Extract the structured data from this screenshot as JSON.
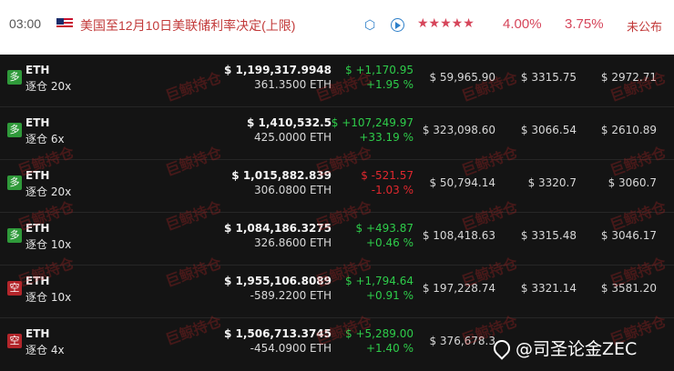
{
  "header": {
    "time": "03:00",
    "title": "美国至12月10日美联储利率决定(上限)",
    "stars": "★★★★★",
    "actual": "4.00%",
    "forecast": "3.75%",
    "status": "未公布"
  },
  "rows": [
    {
      "side": "多",
      "side_type": "long",
      "symbol": "ETH",
      "leverage": "逐仓 20x",
      "value": "$ 1,199,317.9948",
      "qty": "361.3500 ETH",
      "pnl": "$ +1,170.95",
      "pnl_pct": "+1.95 %",
      "pnl_sign": "pos",
      "margin": "$ 59,965.90",
      "entry": "$ 3315.75",
      "liq": "$ 2972.71"
    },
    {
      "side": "多",
      "side_type": "long",
      "symbol": "ETH",
      "leverage": "逐仓 6x",
      "value": "$ 1,410,532.5",
      "qty": "425.0000 ETH",
      "pnl": "$ +107,249.97",
      "pnl_pct": "+33.19 %",
      "pnl_sign": "pos",
      "margin": "$ 323,098.60",
      "entry": "$ 3066.54",
      "liq": "$ 2610.89"
    },
    {
      "side": "多",
      "side_type": "long",
      "symbol": "ETH",
      "leverage": "逐仓 20x",
      "value": "$ 1,015,882.839",
      "qty": "306.0800 ETH",
      "pnl": "$ -521.57",
      "pnl_pct": "-1.03 %",
      "pnl_sign": "neg",
      "margin": "$ 50,794.14",
      "entry": "$ 3320.7",
      "liq": "$ 3060.7"
    },
    {
      "side": "多",
      "side_type": "long",
      "symbol": "ETH",
      "leverage": "逐仓 10x",
      "value": "$ 1,084,186.3275",
      "qty": "326.8600 ETH",
      "pnl": "$ +493.87",
      "pnl_pct": "+0.46 %",
      "pnl_sign": "pos",
      "margin": "$ 108,418.63",
      "entry": "$ 3315.48",
      "liq": "$ 3046.17"
    },
    {
      "side": "空",
      "side_type": "short",
      "symbol": "ETH",
      "leverage": "逐仓 10x",
      "value": "$ 1,955,106.8089",
      "qty": "-589.2200 ETH",
      "pnl": "$ +1,794.64",
      "pnl_pct": "+0.91 %",
      "pnl_sign": "pos",
      "margin": "$ 197,228.74",
      "entry": "$ 3321.14",
      "liq": "$ 3581.20"
    },
    {
      "side": "空",
      "side_type": "short",
      "symbol": "ETH",
      "leverage": "逐仓 4x",
      "value": "$ 1,506,713.3745",
      "qty": "-454.0900 ETH",
      "pnl": "$ +5,289.00",
      "pnl_pct": "+1.40 %",
      "pnl_sign": "pos",
      "margin": "$ 376,678.3",
      "entry": "",
      "liq": ""
    }
  ],
  "watermark": "巨鲸持仓",
  "credit": "@司圣论金ZEC",
  "icons": {
    "flag": "us-flag-icon",
    "cube": "cube-icon",
    "play": "play-icon",
    "credit": "weibo-icon"
  }
}
